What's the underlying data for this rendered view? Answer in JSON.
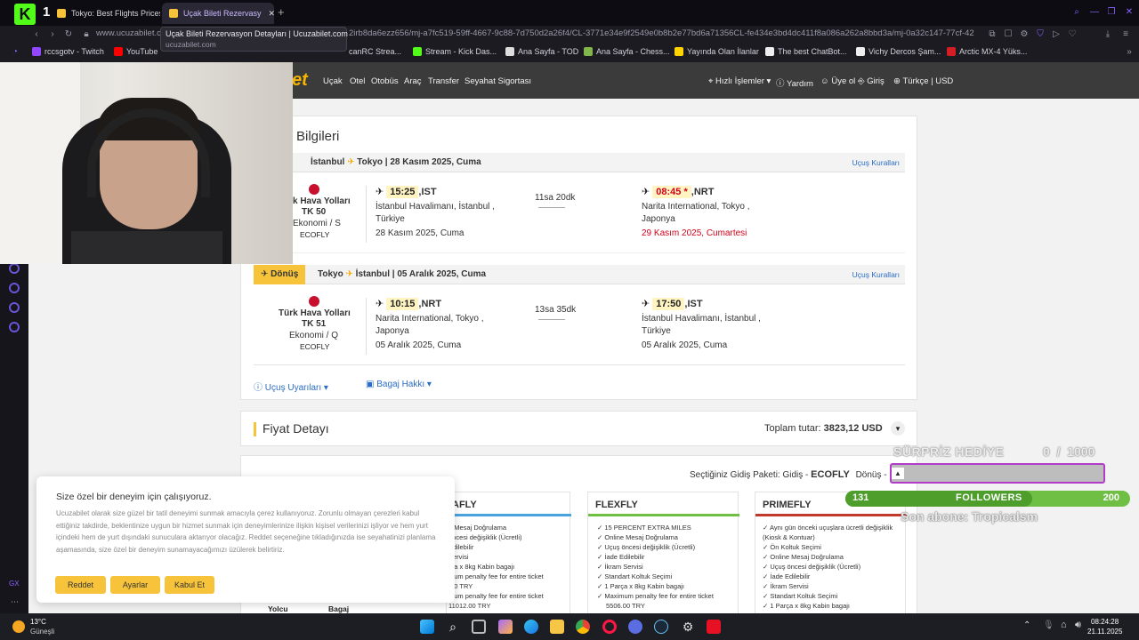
{
  "browser": {
    "tabs": [
      {
        "label": "Tokyo: Best Flights Prices"
      },
      {
        "label": "Uçak Bileti Rezervasy"
      }
    ],
    "url_host": "www.ucuzabilet.c",
    "url_tail": "2irb8da6ezz656/mj-a7fc519-59ff-4667-9c88-7d750d2a26f4/CL-3771e34e9f2549e0b8b2e77bd6a71356CL-fe434e3bd4dc411f8a086a262a8bbd3a/mj-0a32c147-77cf-42",
    "tooltip_title": "Uçak Bileti Rezervasyon Detayları | Ucuzabilet.com",
    "tooltip_host": "ucuzabilet.com",
    "bookmarks": [
      {
        "label": "rccsgotv - Twitch",
        "color": "#9146ff"
      },
      {
        "label": "YouTube",
        "color": "#ff0000"
      },
      {
        "label": "canRC Strea...",
        "color": "#00b6ff"
      },
      {
        "label": "Stream - Kick Das...",
        "color": "#53fc18"
      },
      {
        "label": "Ana Sayfa - TOD",
        "color": "#ffffff"
      },
      {
        "label": "Ana Sayfa - Chess...",
        "color": "#81b64c"
      },
      {
        "label": "Yayında Olan İlanlar",
        "color": "#ffd300"
      },
      {
        "label": "The best ChatBot...",
        "color": "#ffffff"
      },
      {
        "label": "Vichy Dercos Şam...",
        "color": "#ffffff"
      },
      {
        "label": "Arctic MX-4 Yüks...",
        "color": "#d31e25"
      }
    ]
  },
  "site": {
    "logo_fragment": "et",
    "nav_left": [
      "Uçak",
      "Otel",
      "Otobüs",
      "Araç",
      "Transfer",
      "Seyahat Sigortası"
    ],
    "nav_right": [
      "Hızlı İşlemler",
      "Yardım",
      "Üye ol",
      "Giriş",
      "Türkçe | USD"
    ]
  },
  "booking": {
    "section_title": "Bilgileri",
    "rules_link": "Uçuş Kuralları",
    "outbound": {
      "from": "İstanbul",
      "to": "Tokyo",
      "date_header": "| 28 Kasım 2025, Cuma",
      "airline": "k Hava Yolları",
      "flight_no": "TK 50",
      "cabin": "Ekonomi / S",
      "fare": "ECOFLY",
      "dep_time": "15:25",
      "dep_code": ",IST",
      "dep_airport": "İstanbul Havalimanı, İstanbul ,",
      "dep_country": "Türkiye",
      "dep_date": "28 Kasım 2025, Cuma",
      "duration": "11sa 20dk",
      "arr_time": "08:45 *",
      "arr_code": ",NRT",
      "arr_airport": "Narita International, Tokyo ,",
      "arr_country": "Japonya",
      "arr_date": "29 Kasım 2025, Cumartesi"
    },
    "return": {
      "tag": "Dönüş",
      "from": "Tokyo",
      "to": "İstanbul",
      "date_header": "| 05 Aralık 2025, Cuma",
      "airline": "Türk Hava Yolları",
      "flight_no": "TK 51",
      "cabin": "Ekonomi / Q",
      "fare": "ECOFLY",
      "dep_time": "10:15",
      "dep_code": ",NRT",
      "dep_airport": "Narita International, Tokyo ,",
      "dep_country": "Japonya",
      "dep_date": "05 Aralık 2025, Cuma",
      "duration": "13sa 35dk",
      "arr_time": "17:50",
      "arr_code": ",IST",
      "arr_airport": "İstanbul Havalimanı, İstanbul ,",
      "arr_country": "Türkiye",
      "arr_date": "05 Aralık 2025, Cuma"
    },
    "warnings_link": "Uçuş Uyarıları",
    "baggage_link": "Bagaj Hakkı"
  },
  "price": {
    "title": "Fiyat Detayı",
    "total_label": "Toplam tutar:",
    "total_value": "3823,12 USD",
    "selected_label": "Seçtiğiniz Gidiş Paketi: Gidiş -",
    "selected_value": "ECOFLY",
    "return_label": "Dönüş -",
    "passenger_col": "Yolcu",
    "baggage_col": "Bagaj",
    "packages": [
      {
        "name": "AFLY",
        "color": "#4aa3df",
        "items": [
          "e Mesaj Doğrulama",
          "öncesi değişiklik (Ücretli)",
          "Edilebilir",
          "Servisi",
          "rça x 8kg Kabin bagajı",
          "mum penalty fee for entire ticket",
          ".00 TRY",
          "mum penalty fee for entire ticket",
          "11012.00 TRY"
        ]
      },
      {
        "name": "FLEXFLY",
        "color": "#6fbf45",
        "items": [
          "✓ 15 PERCENT EXTRA MILES",
          "✓ Online Mesaj Doğrulama",
          "✓ Uçuş öncesi değişiklik (Ücretli)",
          "✓ İade Edilebilir",
          "✓ İkram Servisi",
          "✓ Standart Koltuk Seçimi",
          "✓ 1 Parça x 8kg Kabin bagajı",
          "✓ Maximum penalty fee for entire ticket",
          "5506.00 TRY"
        ]
      },
      {
        "name": "PRIMEFLY",
        "color": "#c0392b",
        "items": [
          "✓ Aynı gün önceki uçuşlara ücretli değişiklik (Kiosk & Kontuar)",
          "✓ Ön Koltuk Seçimi",
          "✓ Online Mesaj Doğrulama",
          "✓ Uçuş öncesi değişiklik (Ücretli)",
          "✓ İade Edilebilir",
          "✓ İkram Servisi",
          "✓ Standart Koltuk Seçimi",
          "✓ 1 Parça x 8kg Kabin bagajı"
        ]
      }
    ]
  },
  "cookie": {
    "title": "Size özel bir deneyim için çalışıyoruz.",
    "body": "Ucuzabilet olarak size güzel bir tatil deneyimi sunmak amacıyla çerez kullanıyoruz. Zorunlu olmayan çerezleri kabul ettiğiniz takdirde, beklentinize uygun bir hizmet sunmak için deneyimlerinize ilişkin kişisel verilerinizi işliyor ve hem yurt içindeki hem de yurt dışındaki sunuculara aktarıyor olacağız. Reddet seçeneğine tıkladığınızda ise seyahatinizi planlama aşamasında, size özel bir deneyim sunamayacağımızı üzülerek belirtiriz.",
    "reject": "Reddet",
    "settings": "Ayarlar",
    "accept": "Kabul Et"
  },
  "stream_overlay": {
    "gift_label": "SÜRPRİZ HEDİYE",
    "gift_progress": "0  /  1000",
    "gift_progress_fraction": 0,
    "followers_current": "131",
    "followers_label": "FOLLOWERS",
    "followers_goal": "200",
    "followers_fraction": 0.655,
    "last_sub": "Son abone: Tropicalsm"
  },
  "taskbar": {
    "weather_temp": "13°C",
    "weather_desc": "Güneşli",
    "time": "08:24:28",
    "date": "21.11.2025"
  }
}
